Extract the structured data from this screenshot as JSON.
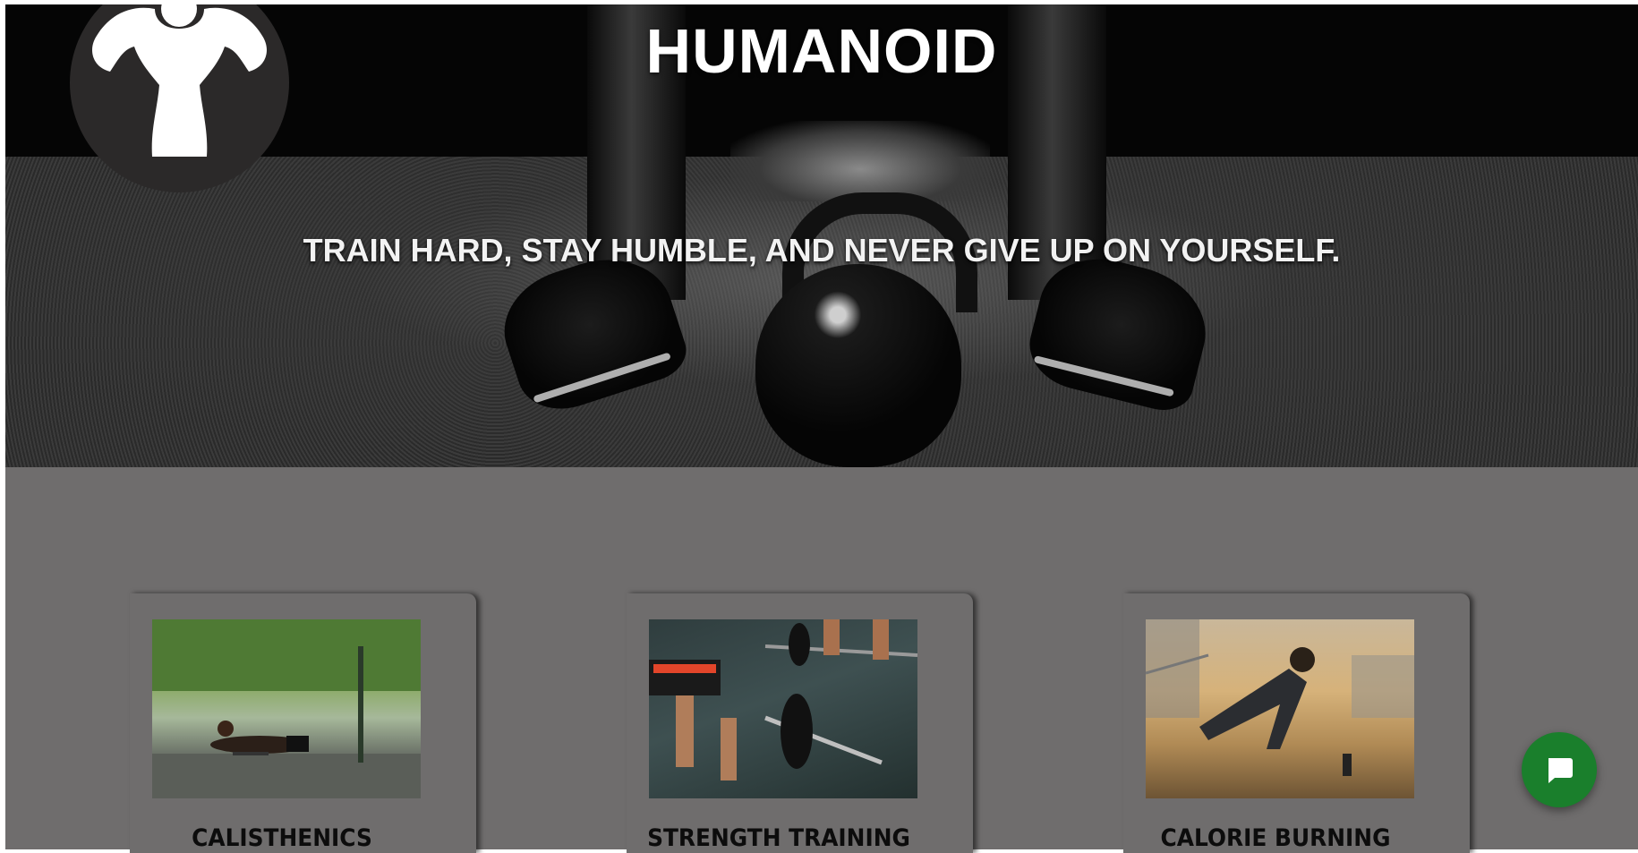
{
  "hero": {
    "title": "HUMANOID",
    "tagline": "TRAIN HARD, STAY HUMBLE, AND NEVER GIVE UP ON YOURSELF."
  },
  "logo": {
    "icon": "muscle-man-icon"
  },
  "cards": [
    {
      "title": "CALISTHENICS",
      "image": "pushup-park-photo"
    },
    {
      "title": "STRENGTH TRAINING",
      "image": "barbell-deadlift-photo"
    },
    {
      "title": "CALORIE BURNING",
      "image": "outdoor-plank-photo"
    }
  ],
  "chat": {
    "icon": "chat-bubble-icon"
  },
  "colors": {
    "page_bg": "#6f6d6d",
    "hero_bg": "#050505",
    "chat_accent": "#1a7f2c",
    "card_title": "#0c0c0c"
  }
}
